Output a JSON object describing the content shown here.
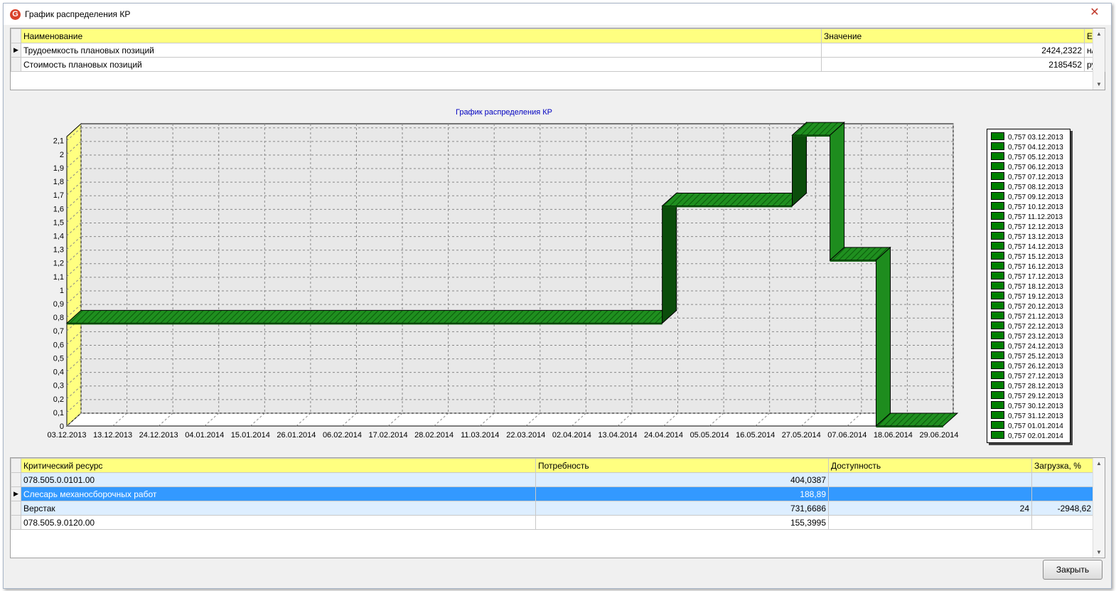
{
  "window": {
    "title": "График распределения КР",
    "close_glyph": "✕",
    "icon_letter": "G"
  },
  "top_grid": {
    "headers": [
      "Наименование",
      "Значение",
      "ЕИ"
    ],
    "rows": [
      {
        "name": "Трудоемкость плановых позиций",
        "value": "2424,2322",
        "unit": "н/ч"
      },
      {
        "name": "Стоимость плановых позиций",
        "value": "2185452",
        "unit": "руб"
      }
    ]
  },
  "chart_data": {
    "type": "area",
    "title": "График распределения КР",
    "x_tick_labels": [
      "03.12.2013",
      "13.12.2013",
      "24.12.2013",
      "04.01.2014",
      "15.01.2014",
      "26.01.2014",
      "06.02.2014",
      "17.02.2014",
      "28.02.2014",
      "11.03.2014",
      "22.03.2014",
      "02.04.2014",
      "13.04.2014",
      "24.04.2014",
      "05.05.2014",
      "16.05.2014",
      "27.05.2014",
      "07.06.2014",
      "18.06.2014",
      "29.06.2014"
    ],
    "y_tick_labels": [
      "0",
      "0,1",
      "0,2",
      "0,3",
      "0,4",
      "0,5",
      "0,6",
      "0,7",
      "0,8",
      "0,9",
      "1",
      "1,1",
      "1,2",
      "1,3",
      "1,4",
      "1,5",
      "1,6",
      "1,7",
      "1,8",
      "1,9",
      "2",
      "2,1"
    ],
    "ylim": [
      0,
      2.13
    ],
    "grid": true,
    "series_color": "#1f8f1f",
    "steps": [
      {
        "from": "03.12.2013",
        "to": "24.04.2014",
        "value": 0.757
      },
      {
        "from": "24.04.2014",
        "to": "25.05.2014",
        "value": 1.62
      },
      {
        "from": "25.05.2014",
        "to": "03.06.2014",
        "value": 2.14
      },
      {
        "from": "03.06.2014",
        "to": "14.06.2014",
        "value": 1.22
      },
      {
        "from": "14.06.2014",
        "to": "30.06.2014",
        "value": 0
      }
    ],
    "legend_position": "right",
    "legend": [
      "0,757 03.12.2013",
      "0,757 04.12.2013",
      "0,757 05.12.2013",
      "0,757 06.12.2013",
      "0,757 07.12.2013",
      "0,757 08.12.2013",
      "0,757 09.12.2013",
      "0,757 10.12.2013",
      "0,757 11.12.2013",
      "0,757 12.12.2013",
      "0,757 13.12.2013",
      "0,757 14.12.2013",
      "0,757 15.12.2013",
      "0,757 16.12.2013",
      "0,757 17.12.2013",
      "0,757 18.12.2013",
      "0,757 19.12.2013",
      "0,757 20.12.2013",
      "0,757 21.12.2013",
      "0,757 22.12.2013",
      "0,757 23.12.2013",
      "0,757 24.12.2013",
      "0,757 25.12.2013",
      "0,757 26.12.2013",
      "0,757 27.12.2013",
      "0,757 28.12.2013",
      "0,757 29.12.2013",
      "0,757 30.12.2013",
      "0,757 31.12.2013",
      "0,757 01.01.2014",
      "0,757 02.01.2014"
    ]
  },
  "bottom_grid": {
    "headers": [
      "Критический ресурс",
      "Потребность",
      "Доступность",
      "Загрузка, %"
    ],
    "rows": [
      {
        "name": "078.505.0.0101.00",
        "need": "404,0387",
        "avail": "",
        "load": "",
        "style": "blue"
      },
      {
        "name": "Слесарь механосборочных работ",
        "need": "188,89",
        "avail": "",
        "load": "",
        "style": "selected"
      },
      {
        "name": "Верстак",
        "need": "731,6686",
        "avail": "24",
        "load": "-2948,62",
        "style": "blue"
      },
      {
        "name": "078.505.9.0120.00",
        "need": "155,3995",
        "avail": "",
        "load": "",
        "style": "white"
      }
    ]
  },
  "footer": {
    "close_label": "Закрыть"
  }
}
